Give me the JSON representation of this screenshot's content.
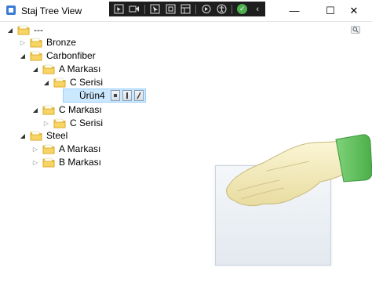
{
  "window": {
    "title": "Staj Tree View",
    "controls": {
      "minimize": "—",
      "maximize": "☐",
      "close": "✕"
    }
  },
  "devtools": {
    "items": [
      "select-element-icon",
      "record-icon",
      "pointer-icon",
      "frame-icon",
      "layout-icon",
      "hot-reload-icon",
      "accessibility-icon",
      "check-ok-icon",
      "collapse-icon"
    ]
  },
  "tree": {
    "root": {
      "label": "---"
    },
    "bronze": {
      "label": "Bronze"
    },
    "carbonfiber": {
      "label": "Carbonfiber"
    },
    "a_markasi": {
      "label": "A Markası"
    },
    "c_serisi_1": {
      "label": "C Serisi"
    },
    "urun4": {
      "label": "Ürün4"
    },
    "c_markasi": {
      "label": "C Markası"
    },
    "c_serisi_2": {
      "label": "C Serisi"
    },
    "steel": {
      "label": "Steel"
    },
    "a_markasi_2": {
      "label": "A Markası"
    },
    "b_markasi": {
      "label": "B Markası"
    }
  },
  "colors": {
    "selection": "#cce8ff",
    "folder": "#f2c744",
    "devbar": "#1e1e1e",
    "ok": "#4caf50"
  }
}
